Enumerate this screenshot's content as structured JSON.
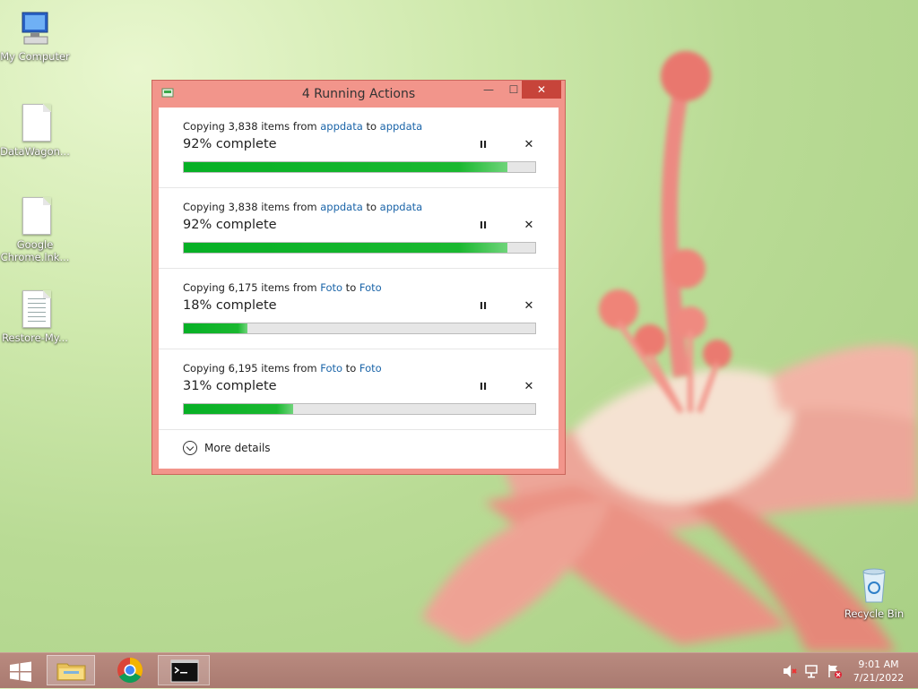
{
  "desktop": {
    "icons": [
      {
        "label": "My Computer"
      },
      {
        "label": "DataWagon..."
      },
      {
        "label": "Google Chrome.lnk..."
      },
      {
        "label": "Restore-My..."
      },
      {
        "label": "Recycle Bin"
      }
    ]
  },
  "window": {
    "title": "4 Running Actions",
    "controls": {
      "minimize": "—",
      "maximize": "☐",
      "close": "✕"
    },
    "operations": [
      {
        "prefix": "Copying 3,838 items from ",
        "source": "appdata",
        "middle": " to ",
        "dest": "appdata",
        "percent_text": "92% complete",
        "progress": 92
      },
      {
        "prefix": "Copying 3,838 items from ",
        "source": "appdata",
        "middle": " to ",
        "dest": "appdata",
        "percent_text": "92% complete",
        "progress": 92
      },
      {
        "prefix": "Copying 6,175 items from ",
        "source": "Foto",
        "middle": " to ",
        "dest": "Foto",
        "percent_text": "18% complete",
        "progress": 18
      },
      {
        "prefix": "Copying 6,195 items from ",
        "source": "Foto",
        "middle": " to ",
        "dest": "Foto",
        "percent_text": "31% complete",
        "progress": 31
      }
    ],
    "pause_glyph": "II",
    "cancel_glyph": "✕",
    "more_details": "More details"
  },
  "taskbar": {
    "items": [
      "file-explorer",
      "google-chrome",
      "command-prompt"
    ],
    "clock": {
      "time": "9:01 AM",
      "date": "7/21/2022"
    }
  },
  "colors": {
    "accent": "#f2958b",
    "progress": "#06b025",
    "link": "#1a64a8",
    "taskbar": "#b08276"
  }
}
